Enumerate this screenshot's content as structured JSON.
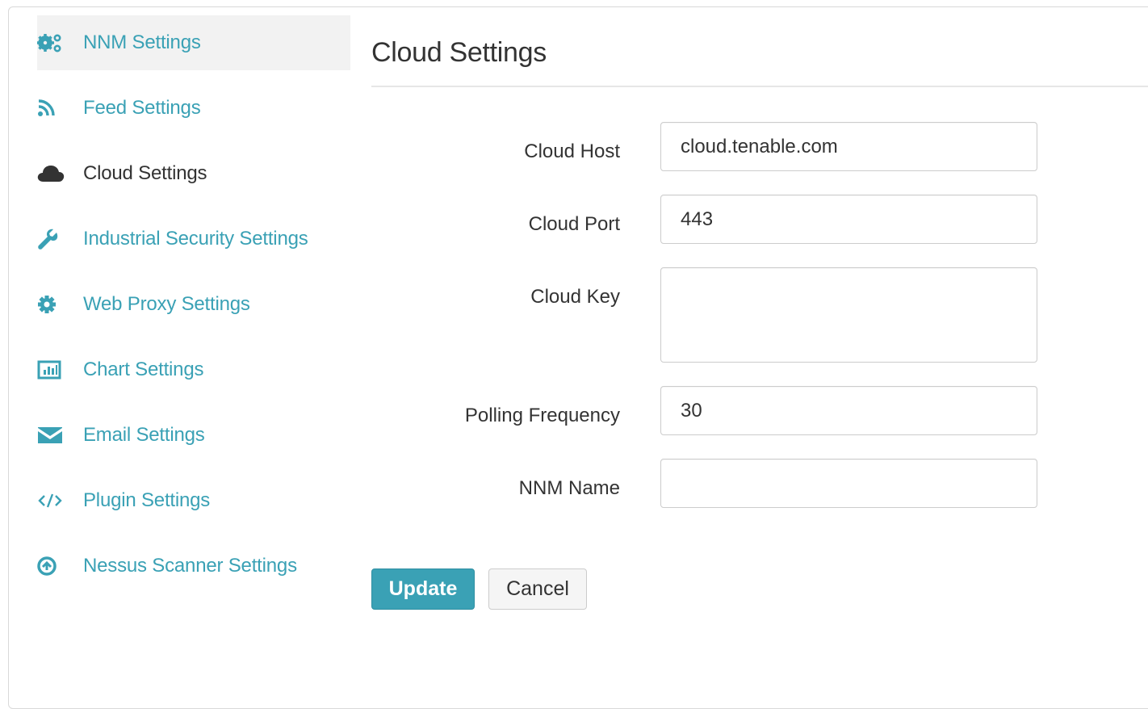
{
  "sidebar": {
    "items": [
      {
        "label": "NNM Settings",
        "icon": "gears-icon"
      },
      {
        "label": "Feed Settings",
        "icon": "rss-icon"
      },
      {
        "label": "Cloud Settings",
        "icon": "cloud-icon"
      },
      {
        "label": "Industrial Security Settings",
        "icon": "wrench-icon"
      },
      {
        "label": "Web Proxy Settings",
        "icon": "gear-icon"
      },
      {
        "label": "Chart Settings",
        "icon": "bar-chart-icon"
      },
      {
        "label": "Email Settings",
        "icon": "envelope-icon"
      },
      {
        "label": "Plugin Settings",
        "icon": "code-icon"
      },
      {
        "label": "Nessus Scanner Settings",
        "icon": "arrow-circle-up-icon"
      }
    ]
  },
  "main": {
    "title": "Cloud Settings",
    "fields": {
      "cloud_host": {
        "label": "Cloud Host",
        "value": "cloud.tenable.com"
      },
      "cloud_port": {
        "label": "Cloud Port",
        "value": "443"
      },
      "cloud_key": {
        "label": "Cloud Key",
        "value": ""
      },
      "polling_frequency": {
        "label": "Polling Frequency",
        "value": "30"
      },
      "nnm_name": {
        "label": "NNM Name",
        "value": ""
      }
    },
    "buttons": {
      "update": "Update",
      "cancel": "Cancel"
    }
  },
  "colors": {
    "accent": "#3aa1b5",
    "text": "#333333",
    "selected_bg": "#f2f2f2"
  }
}
